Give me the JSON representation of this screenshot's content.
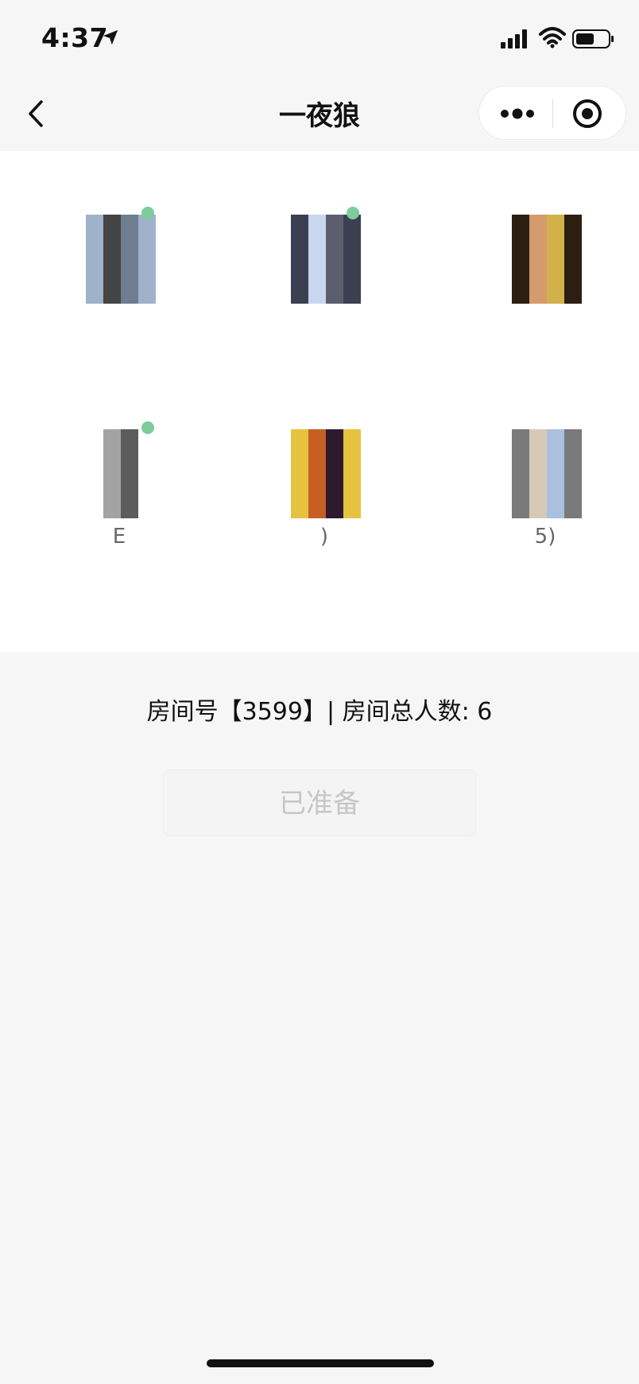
{
  "status_bar": {
    "time": "4:37",
    "icons": [
      "location-arrow-icon",
      "signal-icon",
      "wifi-icon",
      "battery-icon"
    ]
  },
  "nav": {
    "title": "一夜狼",
    "icons": [
      "back-icon",
      "more-icon",
      "close-icon"
    ]
  },
  "players": [
    {
      "name": "",
      "online": true,
      "avatar_colors": [
        "#9fb2c9",
        "#6f7d91",
        "#444"
      ]
    },
    {
      "name": "",
      "online": true,
      "avatar_colors": [
        "#c9d7ee",
        "#3c3f52",
        "#5b5e6c"
      ]
    },
    {
      "name": "",
      "online": false,
      "avatar_colors": [
        "#d2b14a",
        "#d59b6d",
        "#2d1e12"
      ]
    },
    {
      "name": "E",
      "online": true,
      "avatar_colors": [
        "#ffffff",
        "#5c5c5c",
        "#a3a3a3"
      ]
    },
    {
      "name": ")",
      "online": false,
      "avatar_colors": [
        "#c55f23",
        "#e7c23e",
        "#2d1a2e"
      ]
    },
    {
      "name": "5)",
      "online": false,
      "avatar_colors": [
        "#a9c0df",
        "#d8c9b6",
        "#7a7a7a"
      ]
    }
  ],
  "room": {
    "info_text": "房间号【3599】| 房间总人数: 6"
  },
  "ready_button": {
    "label": "已准备"
  },
  "colors": {
    "background": "#f6f6f6",
    "panel": "#ffffff",
    "online_dot": "#7ccc9c",
    "disabled_text": "#c6c6c6"
  }
}
